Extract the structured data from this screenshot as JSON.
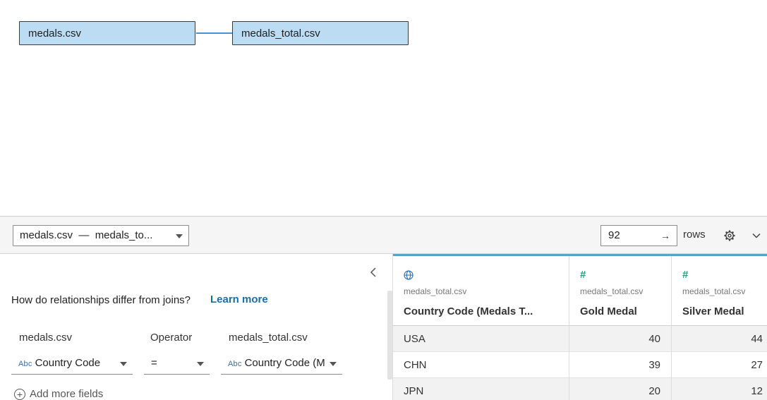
{
  "canvas": {
    "tables": [
      "medals.csv",
      "medals_total.csv"
    ]
  },
  "toolbar": {
    "relationship_select": "medals.csv  —  medals_to...",
    "rows_value": "92",
    "rows_arrow": "→",
    "rows_label": "rows"
  },
  "relationship_panel": {
    "help_text": "How do relationships differ from joins?",
    "learn_more": "Learn more",
    "left_header": "medals.csv",
    "operator_header": "Operator",
    "right_header": "medals_total.csv",
    "left_field_type": "Abc",
    "left_field": "Country Code",
    "operator": "=",
    "right_field_type": "Abc",
    "right_field": "Country Code (M",
    "add_fields": "Add more fields"
  },
  "grid": {
    "columns": [
      {
        "icon": "globe-icon",
        "source": "medals_total.csv",
        "name": "Country Code (Medals T..."
      },
      {
        "icon": "hash-icon",
        "source": "medals_total.csv",
        "name": "Gold Medal"
      },
      {
        "icon": "hash-icon",
        "source": "medals_total.csv",
        "name": "Silver Medal"
      }
    ],
    "rows": [
      [
        "USA",
        "40",
        "44"
      ],
      [
        "CHN",
        "39",
        "27"
      ],
      [
        "JPN",
        "20",
        "12"
      ]
    ]
  },
  "colors": {
    "table_node_fill": "#bcdcf4",
    "noodle": "#4a90d9",
    "link": "#1a6fa6",
    "number_icon": "#1fa37a",
    "geo_icon": "#2f6fb3"
  }
}
